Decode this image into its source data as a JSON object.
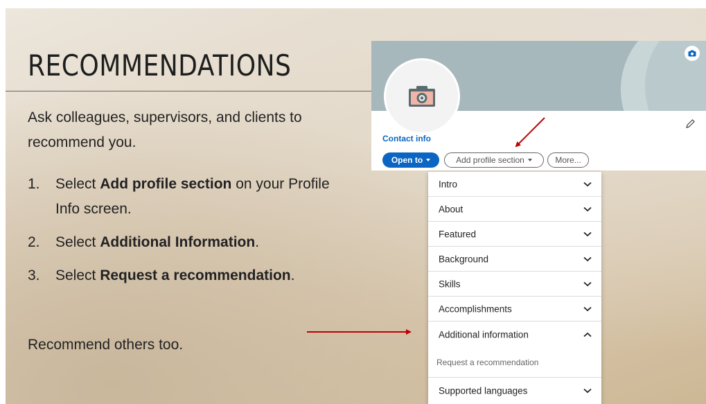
{
  "slide": {
    "title": "RECOMMENDATIONS",
    "intro": "Ask colleagues, supervisors, and clients to recommend you.",
    "steps": [
      {
        "number": "1.",
        "pre": "Select ",
        "bold": "Add profile section",
        "post": " on your Profile Info screen."
      },
      {
        "number": "2.",
        "pre": "Select ",
        "bold": "Additional Information",
        "post": "."
      },
      {
        "number": "3.",
        "pre": "Select ",
        "bold": "Request a recommendation",
        "post": "."
      }
    ],
    "outro": "Recommend others too."
  },
  "profile": {
    "contact_link": "Contact info",
    "open_to_label": "Open to",
    "add_section_label": "Add profile section",
    "more_label": "More..."
  },
  "menu": {
    "items": [
      {
        "label": "Intro",
        "expanded": false
      },
      {
        "label": "About",
        "expanded": false
      },
      {
        "label": "Featured",
        "expanded": false
      },
      {
        "label": "Background",
        "expanded": false
      },
      {
        "label": "Skills",
        "expanded": false
      },
      {
        "label": "Accomplishments",
        "expanded": false
      },
      {
        "label": "Additional information",
        "expanded": true
      },
      {
        "label": "Supported languages",
        "expanded": false
      }
    ],
    "sub_item": "Request a recommendation"
  },
  "colors": {
    "linkedin_blue": "#0a66c2",
    "annotation_arrow": "#c00000"
  },
  "icons": [
    "camera-icon",
    "pencil-icon",
    "cover-camera-icon",
    "chevron-down-icon",
    "chevron-up-icon",
    "caret-down-icon",
    "annotation-arrow"
  ]
}
